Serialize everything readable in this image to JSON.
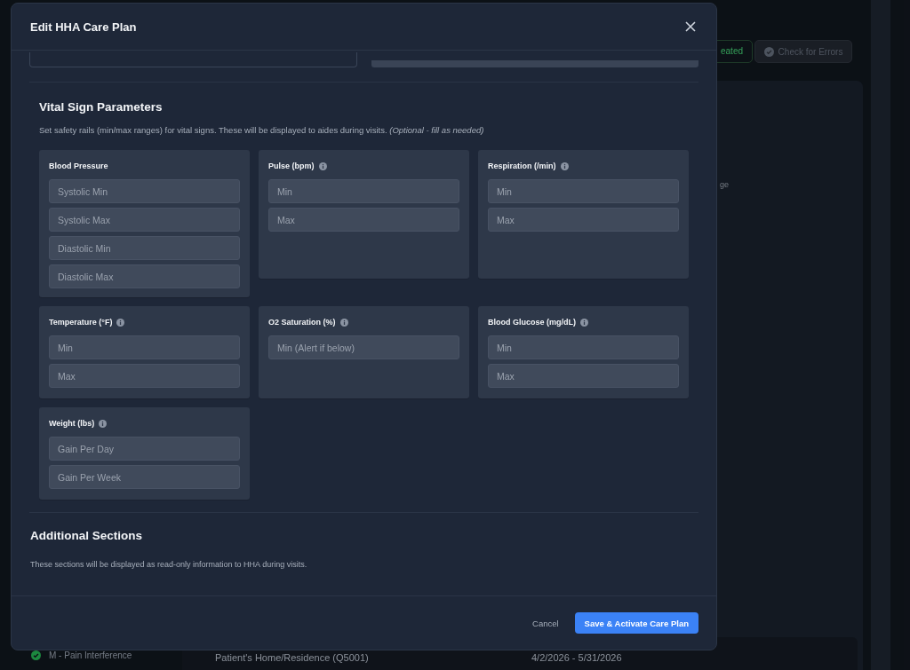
{
  "background": {
    "status_badge": "eated",
    "check_button": "Check for Errors",
    "side_text": "ge",
    "sidebar_item": {
      "label": "M - Pain Interference",
      "done": true
    },
    "row": {
      "location": "Patient's Home/Residence (Q5001)",
      "dates": "4/2/2026 - 5/31/2026"
    }
  },
  "dialog": {
    "title": "Edit HHA Care Plan",
    "partial_fields": [
      {
        "kind": "outlined"
      },
      {
        "kind": "filled"
      }
    ],
    "vitals": {
      "heading": "Vital Sign Parameters",
      "description": "Set safety rails (min/max ranges) for vital signs. These will be displayed to aides during visits. *(Optional - fill as needed)*",
      "groups": [
        {
          "label": "Blood Pressure",
          "info": false,
          "fields": [
            {
              "placeholder": "Systolic Min"
            },
            {
              "placeholder": "Systolic Max"
            },
            {
              "placeholder": "Diastolic Min"
            },
            {
              "placeholder": "Diastolic Max"
            }
          ]
        },
        {
          "label": "Pulse (bpm)",
          "info": true,
          "fields": [
            {
              "placeholder": "Min"
            },
            {
              "placeholder": "Max"
            }
          ]
        },
        {
          "label": "Respiration (/min)",
          "info": true,
          "fields": [
            {
              "placeholder": "Min"
            },
            {
              "placeholder": "Max"
            }
          ]
        },
        {
          "label": "Temperature (°F)",
          "info": true,
          "fields": [
            {
              "placeholder": "Min"
            },
            {
              "placeholder": "Max"
            }
          ]
        },
        {
          "label": "O2 Saturation (%)",
          "info": true,
          "fields": [
            {
              "placeholder": "Min (Alert if below)"
            }
          ]
        },
        {
          "label": "Blood Glucose (mg/dL)",
          "info": true,
          "fields": [
            {
              "placeholder": "Min"
            },
            {
              "placeholder": "Max"
            }
          ]
        },
        {
          "label": "Weight (lbs)",
          "info": true,
          "fields": [
            {
              "placeholder": "Gain Per Day"
            },
            {
              "placeholder": "Gain Per Week"
            }
          ]
        }
      ]
    },
    "additional": {
      "heading": "Additional Sections",
      "description": "These sections will be displayed as read-only information to HHA during visits."
    },
    "buttons": {
      "cancel": "Cancel",
      "primary": "Save & Activate Care Plan"
    }
  }
}
